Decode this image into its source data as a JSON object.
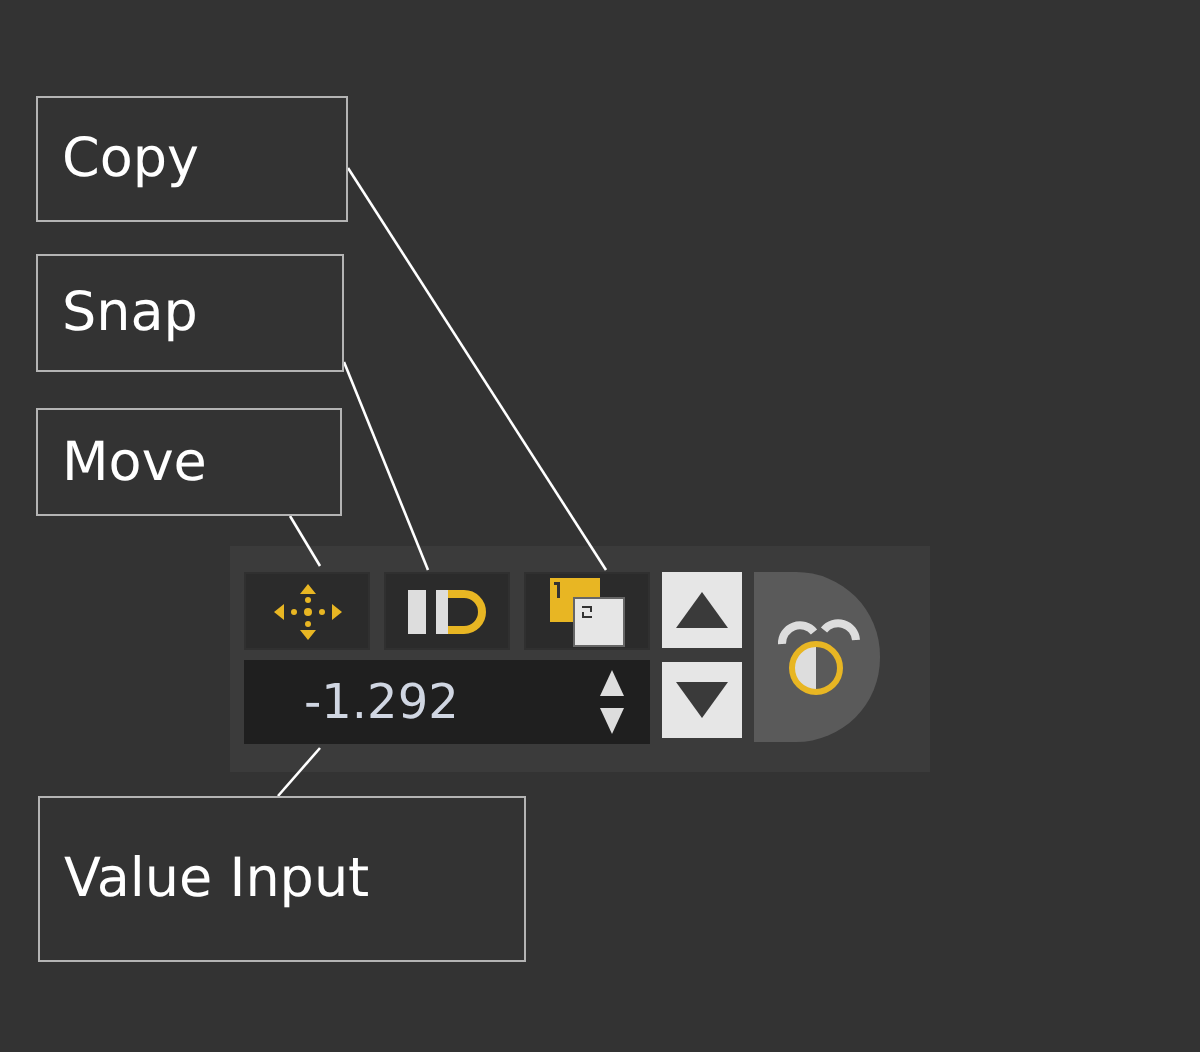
{
  "callouts": [
    {
      "label": "Copy"
    },
    {
      "label": "Snap"
    },
    {
      "label": "Move"
    },
    {
      "label": "Value Input"
    }
  ],
  "value_field": {
    "value": "-1.292"
  }
}
